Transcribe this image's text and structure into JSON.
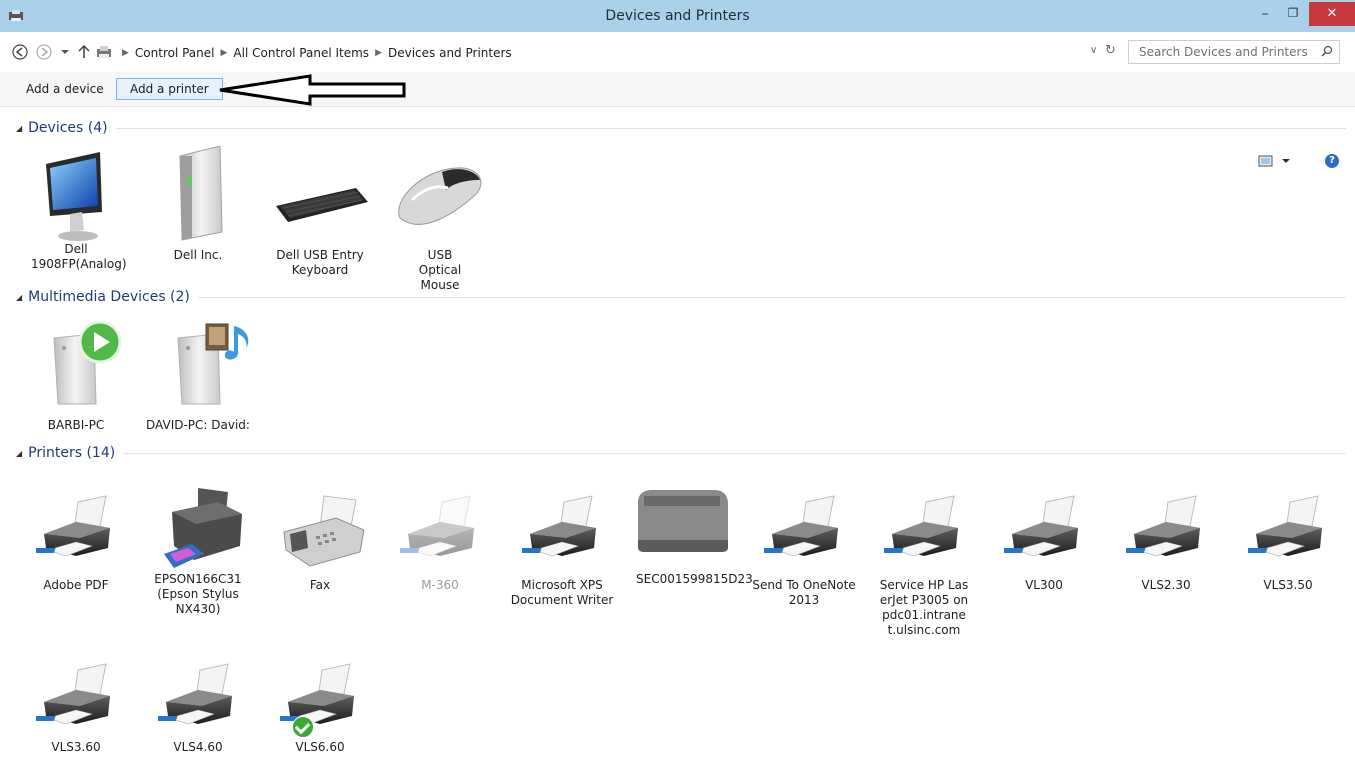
{
  "window": {
    "title": "Devices and Printers",
    "minimize": "–",
    "restore": "❐",
    "close": "✕"
  },
  "address": {
    "breadcrumbs": [
      "Control Panel",
      "All Control Panel Items",
      "Devices and Printers"
    ],
    "search_placeholder": "Search Devices and Printers"
  },
  "commands": {
    "add_device": "Add a device",
    "add_printer": "Add a printer",
    "help": "?"
  },
  "groups": {
    "devices": {
      "title": "Devices (4)",
      "items": [
        {
          "label": "Dell 1908FP(Analog)",
          "icon": "monitor-icon"
        },
        {
          "label": "Dell Inc.",
          "icon": "computer-tower-icon"
        },
        {
          "label": "Dell USB Entry Keyboard",
          "icon": "keyboard-icon"
        },
        {
          "label": "USB Optical Mouse",
          "icon": "mouse-icon"
        }
      ]
    },
    "multimedia": {
      "title": "Multimedia Devices (2)",
      "items": [
        {
          "label": "BARBI-PC",
          "icon": "media-server-play-icon"
        },
        {
          "label": "DAVID-PC: David:",
          "icon": "media-server-music-icon"
        }
      ]
    },
    "printers": {
      "title": "Printers (14)",
      "items": [
        {
          "label": "Adobe PDF",
          "icon": "printer-icon"
        },
        {
          "label": "EPSON166C31 (Epson Stylus NX430)",
          "icon": "inkjet-printer-icon"
        },
        {
          "label": "Fax",
          "icon": "fax-icon"
        },
        {
          "label": "M-360",
          "icon": "printer-faded-icon"
        },
        {
          "label": "Microsoft XPS Document Writer",
          "icon": "printer-icon"
        },
        {
          "label": "SEC001599815D23",
          "icon": "laser-printer-icon"
        },
        {
          "label": "Send To OneNote 2013",
          "icon": "printer-icon"
        },
        {
          "label": "Service HP LaserJet P3005 on pdc01.intranet.ulsinc.com",
          "icon": "printer-icon"
        },
        {
          "label": "VL300",
          "icon": "printer-icon"
        },
        {
          "label": "VLS2.30",
          "icon": "printer-icon"
        },
        {
          "label": "VLS3.50",
          "icon": "printer-icon"
        },
        {
          "label": "VLS3.60",
          "icon": "printer-icon"
        },
        {
          "label": "VLS4.60",
          "icon": "printer-icon"
        },
        {
          "label": "VLS6.60",
          "icon": "printer-default-icon",
          "default": true
        }
      ]
    }
  }
}
